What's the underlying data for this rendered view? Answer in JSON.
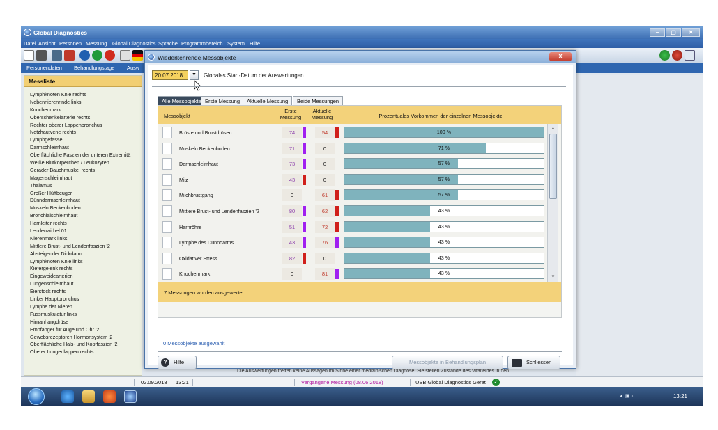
{
  "app": {
    "title": "Global Diagnostics",
    "menu": [
      "Datei",
      "Ansicht",
      "Personen",
      "Messung",
      "Global Diagnostics",
      "Sprache",
      "Programmbereich",
      "System",
      "Hilfe"
    ],
    "tabs": [
      "Personendaten",
      "Behandlungstage",
      "Ausw"
    ]
  },
  "messliste": {
    "title": "Messliste",
    "items": [
      "Lymphknoten Knie rechts",
      "Nebennierenrinde links",
      "Knochenmark",
      "Oberschenkelarterie rechts",
      "Rechter oberer Lappenbronchus",
      "Netzhautvene rechts",
      "Lymphgefässe",
      "Darmschleimhaut",
      "Oberflächliche Faszien der unteren Extremitä",
      "Weiße Blutkörperchen / Leukozyten",
      "Gerader Bauchmuskel rechts",
      "Magenschleimhaut",
      "Thalamus",
      "Großer Hüftbeuger",
      "Dünndarmschleimhaut",
      "Muskeln Beckenboden",
      "Bronchialschleimhaut",
      "Harnleiter rechts",
      "Lendenwirbel 01",
      "Nierenmark links",
      "Mittlere Brust- und Lendenfaszien '2",
      "Absteigender Dickdarm",
      "Lymphknoten Knie links",
      "Kiefergelenk rechts",
      "Eingeweidearterien",
      "Lungenschleimhaut",
      "Eierstock rechts",
      "Linker Hauptbronchus",
      "Lymphe der Nieren",
      "Fussmuskulatur links",
      "Hirnanhangdrüse",
      "Empfänger für Auge und Ohr '2",
      "Gewebsrezeptoren Hormonsystem '2",
      "Oberflächliche Hals- und Kopffaszien '2",
      "Oberer Lungenlappen rechts"
    ]
  },
  "dialog": {
    "title": "Wiederkehrende Messobjekte",
    "close_label": "X",
    "date_value": "20.07.2018",
    "date_label": "Globales Start-Datum der Auswertungen",
    "tabs": [
      "Alle Messobjekte",
      "Erste Messung",
      "Aktuelle Messung",
      "Beide Messungen"
    ],
    "columns": {
      "messobjekt": "Messobjekt",
      "erste": "Erste Messung",
      "aktuelle": "Aktuelle Messung",
      "prozent": "Prozentuales Vorkommen der einzelnen Messobjekte"
    },
    "rows": [
      {
        "name": "Brüste und Brustdrüsen",
        "erste": "74",
        "aktuelle": "54",
        "percent": 100,
        "percent_label": "100 %"
      },
      {
        "name": "Muskeln Beckenboden",
        "erste": "71",
        "aktuelle": "0",
        "percent": 71,
        "percent_label": "71 %"
      },
      {
        "name": "Darmschleimhaut",
        "erste": "73",
        "aktuelle": "0",
        "percent": 57,
        "percent_label": "57 %"
      },
      {
        "name": "Milz",
        "erste": "43",
        "aktuelle": "0",
        "percent": 57,
        "percent_label": "57 %"
      },
      {
        "name": "Milchbrustgang",
        "erste": "0",
        "aktuelle": "61",
        "percent": 57,
        "percent_label": "57 %"
      },
      {
        "name": "Mittlere Brust- und Lendenfaszien '2",
        "erste": "80",
        "aktuelle": "62",
        "percent": 43,
        "percent_label": "43 %"
      },
      {
        "name": "Harnröhre",
        "erste": "51",
        "aktuelle": "72",
        "percent": 43,
        "percent_label": "43 %"
      },
      {
        "name": "Lymphe des Dünndarms",
        "erste": "43",
        "aktuelle": "76",
        "percent": 43,
        "percent_label": "43 %"
      },
      {
        "name": "Oxidativer Stress",
        "erste": "82",
        "aktuelle": "0",
        "percent": 43,
        "percent_label": "43 %"
      },
      {
        "name": "Knochenmark",
        "erste": "0",
        "aktuelle": "81",
        "percent": 43,
        "percent_label": "43 %"
      }
    ],
    "summary": "7 Messungen wurden ausgewertet",
    "selected": "0 Messobjekte ausgewählt",
    "help_label": "Hilfe",
    "plan_label": "Messobjekte in Behandlungsplan",
    "close_button_label": "Schliessen"
  },
  "status": {
    "date": "02.09.2018",
    "time": "13:21",
    "previous": "Vergangene Messung (08.06.2018)",
    "device": "USB Global Diagnostics Gerät",
    "disclaimer": "Die Auswertungen treffen keine Aussagen im Sinne einer medizinischen Diagnose. Sie stellen Zustände des Vitalfeldes in den"
  },
  "taskbar": {
    "clock": "13:21"
  },
  "colors": {
    "purple_bar": "#a020f0",
    "red_bar": "#d0201b",
    "yellow_header": "#f3d27a",
    "teal_fill": "#7fb3bd"
  }
}
